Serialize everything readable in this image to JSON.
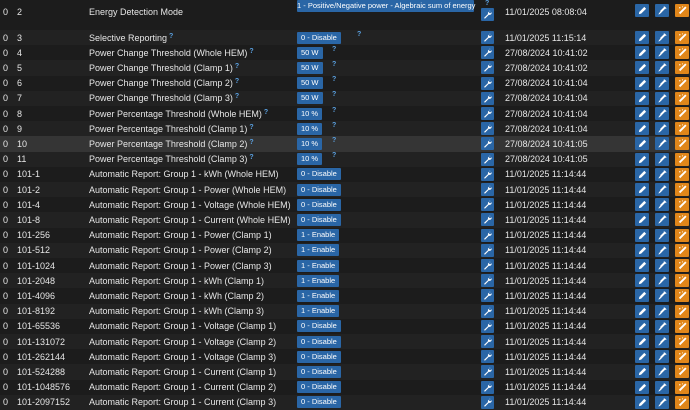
{
  "colors": {
    "background": "#1c1c1c",
    "value_button": "#2a66a6",
    "action_blue": "#2a66a6",
    "action_orange": "#e0861a",
    "help_icon": "#5aa0e0"
  },
  "icons": {
    "help": "?",
    "write": "wrench-icon",
    "edit": "pencil-icon",
    "refresh": "syringe-icon",
    "orange": "wand-icon"
  },
  "rows": [
    {
      "inst": "0",
      "param": "2",
      "name": "Energy Detection Mode",
      "help": "",
      "value": "1 - Positive/Negative power - Algebraic sum of energy",
      "value_help": "?",
      "time": "11/01/2025 08:08:04"
    },
    {
      "inst": "0",
      "param": "3",
      "name": "Selective Reporting",
      "help": "?",
      "value": "0 - Disable",
      "value_help": "?",
      "time": "11/01/2025 11:15:14"
    },
    {
      "inst": "0",
      "param": "4",
      "name": "Power Change Threshold (Whole HEM)",
      "help": "?",
      "value": "50 W",
      "value_help": "?",
      "time": "27/08/2024 10:41:02"
    },
    {
      "inst": "0",
      "param": "5",
      "name": "Power Change Threshold (Clamp 1)",
      "help": "?",
      "value": "50 W",
      "value_help": "?",
      "time": "27/08/2024 10:41:02"
    },
    {
      "inst": "0",
      "param": "6",
      "name": "Power Change Threshold (Clamp 2)",
      "help": "?",
      "value": "50 W",
      "value_help": "?",
      "time": "27/08/2024 10:41:04"
    },
    {
      "inst": "0",
      "param": "7",
      "name": "Power Change Threshold (Clamp 3)",
      "help": "?",
      "value": "50 W",
      "value_help": "?",
      "time": "27/08/2024 10:41:04"
    },
    {
      "inst": "0",
      "param": "8",
      "name": "Power Percentage Threshold (Whole HEM)",
      "help": "?",
      "value": "10 %",
      "value_help": "?",
      "time": "27/08/2024 10:41:04"
    },
    {
      "inst": "0",
      "param": "9",
      "name": "Power Percentage Threshold (Clamp 1)",
      "help": "?",
      "value": "10 %",
      "value_help": "?",
      "time": "27/08/2024 10:41:04"
    },
    {
      "inst": "0",
      "param": "10",
      "name": "Power Percentage Threshold (Clamp 2)",
      "help": "?",
      "value": "10 %",
      "value_help": "?",
      "time": "27/08/2024 10:41:05"
    },
    {
      "inst": "0",
      "param": "11",
      "name": "Power Percentage Threshold (Clamp 3)",
      "help": "?",
      "value": "10 %",
      "value_help": "?",
      "time": "27/08/2024 10:41:05"
    },
    {
      "inst": "0",
      "param": "101-1",
      "name": "Automatic Report: Group 1 - kWh (Whole HEM)",
      "help": "",
      "value": "0 - Disable",
      "value_help": "",
      "time": "11/01/2025 11:14:44"
    },
    {
      "inst": "0",
      "param": "101-2",
      "name": "Automatic Report: Group 1 - Power (Whole HEM)",
      "help": "",
      "value": "0 - Disable",
      "value_help": "",
      "time": "11/01/2025 11:14:44"
    },
    {
      "inst": "0",
      "param": "101-4",
      "name": "Automatic Report: Group 1 - Voltage (Whole HEM)",
      "help": "",
      "value": "0 - Disable",
      "value_help": "",
      "time": "11/01/2025 11:14:44"
    },
    {
      "inst": "0",
      "param": "101-8",
      "name": "Automatic Report: Group 1 - Current (Whole HEM)",
      "help": "",
      "value": "0 - Disable",
      "value_help": "",
      "time": "11/01/2025 11:14:44"
    },
    {
      "inst": "0",
      "param": "101-256",
      "name": "Automatic Report: Group 1 - Power (Clamp 1)",
      "help": "",
      "value": "1 - Enable",
      "value_help": "",
      "time": "11/01/2025 11:14:44"
    },
    {
      "inst": "0",
      "param": "101-512",
      "name": "Automatic Report: Group 1 - Power (Clamp 2)",
      "help": "",
      "value": "1 - Enable",
      "value_help": "",
      "time": "11/01/2025 11:14:44"
    },
    {
      "inst": "0",
      "param": "101-1024",
      "name": "Automatic Report: Group 1 - Power (Clamp 3)",
      "help": "",
      "value": "1 - Enable",
      "value_help": "",
      "time": "11/01/2025 11:14:44"
    },
    {
      "inst": "0",
      "param": "101-2048",
      "name": "Automatic Report: Group 1 - kWh (Clamp 1)",
      "help": "",
      "value": "1 - Enable",
      "value_help": "",
      "time": "11/01/2025 11:14:44"
    },
    {
      "inst": "0",
      "param": "101-4096",
      "name": "Automatic Report: Group 1 - kWh (Clamp 2)",
      "help": "",
      "value": "1 - Enable",
      "value_help": "",
      "time": "11/01/2025 11:14:44"
    },
    {
      "inst": "0",
      "param": "101-8192",
      "name": "Automatic Report: Group 1 - kWh (Clamp 3)",
      "help": "",
      "value": "1 - Enable",
      "value_help": "",
      "time": "11/01/2025 11:14:44"
    },
    {
      "inst": "0",
      "param": "101-65536",
      "name": "Automatic Report: Group 1 - Voltage (Clamp 1)",
      "help": "",
      "value": "0 - Disable",
      "value_help": "",
      "time": "11/01/2025 11:14:44"
    },
    {
      "inst": "0",
      "param": "101-131072",
      "name": "Automatic Report: Group 1 - Voltage (Clamp 2)",
      "help": "",
      "value": "0 - Disable",
      "value_help": "",
      "time": "11/01/2025 11:14:44"
    },
    {
      "inst": "0",
      "param": "101-262144",
      "name": "Automatic Report: Group 1 - Voltage (Clamp 3)",
      "help": "",
      "value": "0 - Disable",
      "value_help": "",
      "time": "11/01/2025 11:14:44"
    },
    {
      "inst": "0",
      "param": "101-524288",
      "name": "Automatic Report: Group 1 - Current (Clamp 1)",
      "help": "",
      "value": "0 - Disable",
      "value_help": "",
      "time": "11/01/2025 11:14:44"
    },
    {
      "inst": "0",
      "param": "101-1048576",
      "name": "Automatic Report: Group 1 - Current (Clamp 2)",
      "help": "",
      "value": "0 - Disable",
      "value_help": "",
      "time": "11/01/2025 11:14:44"
    },
    {
      "inst": "0",
      "param": "101-2097152",
      "name": "Automatic Report: Group 1 - Current (Clamp 3)",
      "help": "",
      "value": "0 - Disable",
      "value_help": "",
      "time": "11/01/2025 11:14:44"
    }
  ]
}
